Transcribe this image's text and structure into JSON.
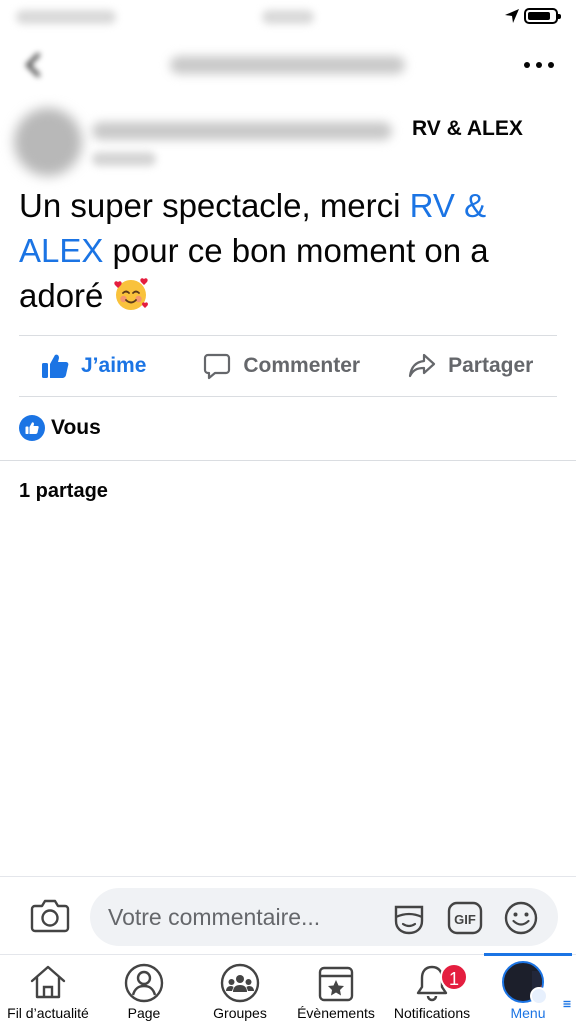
{
  "top_bar": {
    "more_icon": "ellipsis-icon"
  },
  "post": {
    "tagged_page": "RV & ALEX",
    "text_before": "Un super spectacle, merci ",
    "text_link": "RV & ALEX",
    "text_after": " pour ce bon moment on a adoré ",
    "emoji": "smiling-face-with-hearts"
  },
  "actions": {
    "like_label": "J’aime",
    "comment_label": "Commenter",
    "share_label": "Partager"
  },
  "reactions": {
    "text": "Vous"
  },
  "shares": {
    "text": "1 partage"
  },
  "comment_bar": {
    "placeholder": "Votre commentaire...",
    "gif_label": "GIF"
  },
  "tabs": [
    {
      "label": "Fil d’actualité",
      "icon": "home-icon"
    },
    {
      "label": "Page",
      "icon": "page-icon"
    },
    {
      "label": "Groupes",
      "icon": "groups-icon"
    },
    {
      "label": "Évènements",
      "icon": "calendar-icon"
    },
    {
      "label": "Notifications",
      "icon": "bell-icon",
      "badge": "1"
    },
    {
      "label": "Menu",
      "icon": "avatar",
      "active": true
    }
  ],
  "colors": {
    "accent": "#1b74e4",
    "badge": "#e41e3f",
    "muted_text": "#65676b"
  }
}
